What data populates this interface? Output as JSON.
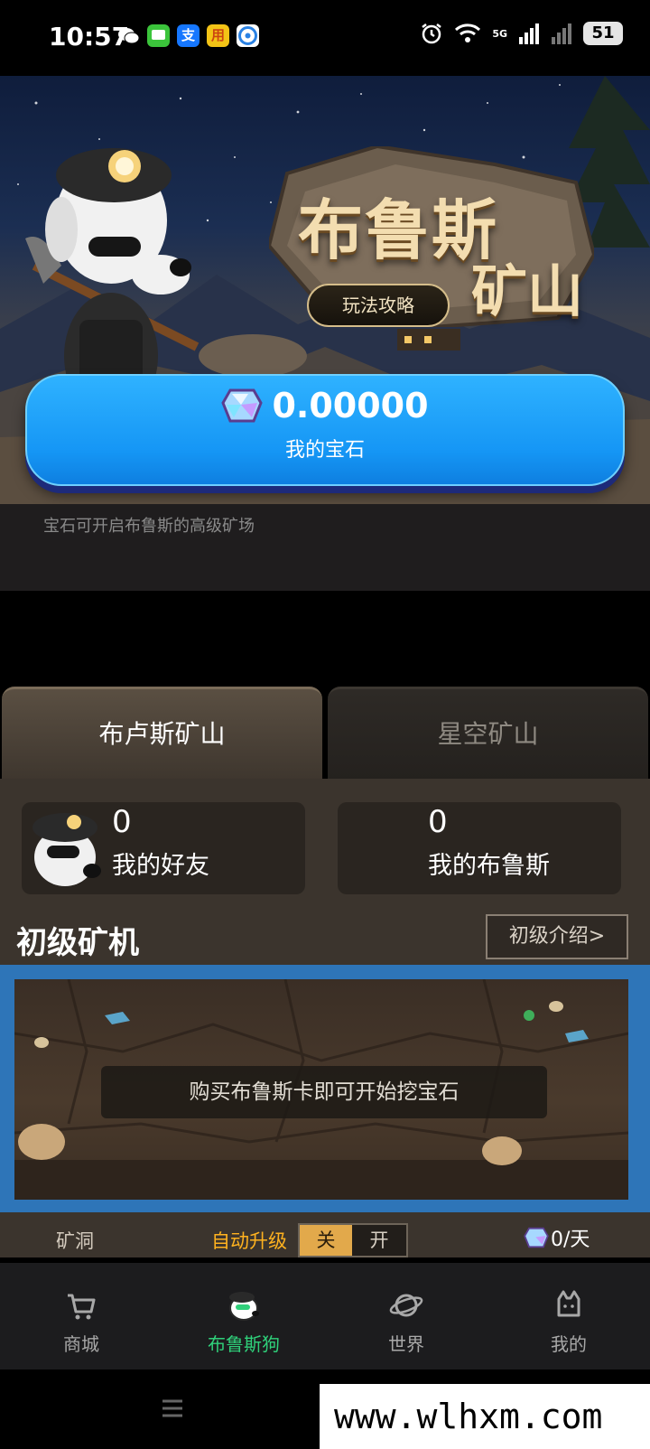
{
  "status_bar": {
    "time": "10:57",
    "apps": [
      {
        "name": "wechat-icon",
        "glyph": "●",
        "color": "#07c160"
      },
      {
        "name": "message-icon",
        "glyph": "▪",
        "color": "#3bc43b"
      },
      {
        "name": "alipay-icon",
        "glyph": "支",
        "color": "#1677ff"
      },
      {
        "name": "app-icon",
        "glyph": "■",
        "color": "#f3c316"
      },
      {
        "name": "browser-icon",
        "glyph": "◉",
        "color": "#2a82e4"
      }
    ],
    "network": "5G",
    "battery": "51"
  },
  "hero": {
    "title_line1": "布鲁斯",
    "title_line2": "矿山",
    "guide_button": "玩法攻略",
    "gem_value": "0.00000",
    "gem_label": "我的宝石",
    "hint": "宝石可开启布鲁斯的高级矿场"
  },
  "tabs": [
    {
      "label": "布卢斯矿山",
      "active": true
    },
    {
      "label": "星空矿山",
      "active": false
    }
  ],
  "stats": {
    "friends": {
      "value": "0",
      "label": "我的好友"
    },
    "bruce": {
      "value": "0",
      "label": "我的布鲁斯"
    }
  },
  "miner": {
    "title": "初级矿机",
    "intro_button": "初级介绍>",
    "message": "购买布鲁斯卡即可开始挖宝石",
    "cave_label": "矿洞",
    "auto_upgrade_label": "自动升级",
    "toggle_off": "关",
    "toggle_on": "开",
    "rate": "0/天"
  },
  "bottom_nav": [
    {
      "label": "商城",
      "icon": "cart-icon",
      "active": false
    },
    {
      "label": "布鲁斯狗",
      "icon": "dog-icon",
      "active": true
    },
    {
      "label": "世界",
      "icon": "planet-icon",
      "active": false
    },
    {
      "label": "我的",
      "icon": "profile-icon",
      "active": false
    }
  ],
  "watermark": "www.wlhxm.com",
  "colors": {
    "accent_green": "#2fd07a",
    "gem_blue": "#1596f5",
    "toggle_gold": "#e2a94b",
    "auto_upgrade_orange": "#ffb21f"
  }
}
